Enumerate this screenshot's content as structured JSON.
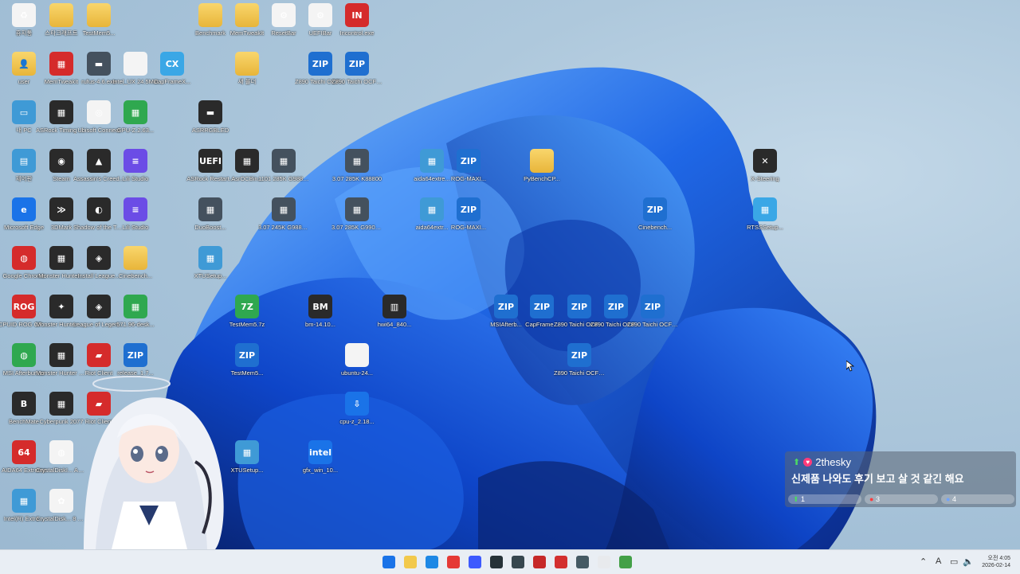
{
  "desktop": {
    "icons": [
      {
        "label": "휴지통",
        "glyph": "♻",
        "style": "g-white"
      },
      {
        "label": "스타크래프트",
        "glyph": "",
        "style": "g-folder"
      },
      {
        "label": "TestMem5...",
        "glyph": "",
        "style": "g-folder"
      },
      {
        "label": "Benchmark",
        "glyph": "",
        "style": "g-folder"
      },
      {
        "label": "MemTweakIt",
        "glyph": "",
        "style": "g-folder"
      },
      {
        "label": "ResetBar",
        "glyph": "⚙",
        "style": "g-white"
      },
      {
        "label": "UEFIBar",
        "glyph": "⚙",
        "style": "g-white"
      },
      {
        "label": "Incontrol.exe",
        "glyph": "IN",
        "style": "g-red"
      },
      {
        "label": "user",
        "glyph": "👤",
        "style": "g-folder"
      },
      {
        "label": "MemTweakIt",
        "glyph": "▦",
        "style": "g-red"
      },
      {
        "label": "rufus-4.6.exe",
        "glyph": "▬",
        "style": "g-gray"
      },
      {
        "label": "Intel_UX 24.5Mxt",
        "glyph": "",
        "style": "g-white"
      },
      {
        "label": "CapFrameX...",
        "glyph": "CX",
        "style": "g-cyan"
      },
      {
        "label": "새 폴더",
        "glyph": "",
        "style": "g-folder"
      },
      {
        "label": "Z890 Taichi OCF(3.03)R...",
        "glyph": "ZIP",
        "style": "g-zip"
      },
      {
        "label": "Z890 Taichi OCF(3.07)R...",
        "glyph": "ZIP",
        "style": "g-zip"
      },
      {
        "label": "내 PC",
        "glyph": "▭",
        "style": "g-teal"
      },
      {
        "label": "ASRock Timing Co...",
        "glyph": "▦",
        "style": "g-dark"
      },
      {
        "label": "Ubisoft Connect",
        "glyph": "◎",
        "style": "g-white"
      },
      {
        "label": "GPU-Z.2.63...",
        "glyph": "▦",
        "style": "g-green"
      },
      {
        "label": "ASRRGBLED",
        "glyph": "▬",
        "style": "g-dark"
      },
      {
        "label": "제어판",
        "glyph": "▤",
        "style": "g-teal"
      },
      {
        "label": "Steam",
        "glyph": "◉",
        "style": "g-dark"
      },
      {
        "label": "Assassin's Creed...",
        "glyph": "▲",
        "style": "g-dark"
      },
      {
        "label": "Lili Studio",
        "glyph": "≡",
        "style": "g-purple"
      },
      {
        "label": "ASRock Restart...",
        "glyph": "UEFI",
        "style": "g-dark"
      },
      {
        "label": "AsrOCBin...",
        "glyph": "▦",
        "style": "g-dark"
      },
      {
        "label": "1101 285K G98800 C...",
        "glyph": "▦",
        "style": "g-gray"
      },
      {
        "label": "3.07 285K K88800",
        "glyph": "▦",
        "style": "g-gray"
      },
      {
        "label": "aida64extre...",
        "glyph": "▦",
        "style": "g-teal"
      },
      {
        "label": "ROG-MAXI...",
        "glyph": "ZIP",
        "style": "g-zip"
      },
      {
        "label": "PyBenchCP...",
        "glyph": "",
        "style": "g-folder"
      },
      {
        "label": "X-Steering",
        "glyph": "✕",
        "style": "g-dark"
      },
      {
        "label": "Microsoft Edge",
        "glyph": "e",
        "style": "g-blue"
      },
      {
        "label": "3DMark",
        "glyph": "≫",
        "style": "g-dark"
      },
      {
        "label": "Shadow of the Tomb...",
        "glyph": "◐",
        "style": "g-dark"
      },
      {
        "label": "Lili Studio",
        "glyph": "≡",
        "style": "g-purple"
      },
      {
        "label": "DuoBoost...",
        "glyph": "▦",
        "style": "g-gray"
      },
      {
        "label": "3.07 245K G98800...",
        "glyph": "▦",
        "style": "g-gray"
      },
      {
        "label": "3.07 285K G99000...",
        "glyph": "▦",
        "style": "g-gray"
      },
      {
        "label": "aida64extr...",
        "glyph": "▦",
        "style": "g-teal"
      },
      {
        "label": "ROG-MAXI...",
        "glyph": "ZIP",
        "style": "g-zip"
      },
      {
        "label": "Cinebench...",
        "glyph": "ZIP",
        "style": "g-zip"
      },
      {
        "label": "RTSSSetup...",
        "glyph": "▦",
        "style": "g-cyan"
      },
      {
        "label": "Google Chrome",
        "glyph": "◍",
        "style": "g-red"
      },
      {
        "label": "Monster Hunter...",
        "glyph": "▦",
        "style": "g-dark"
      },
      {
        "label": "Install League...",
        "glyph": "◈",
        "style": "g-dark"
      },
      {
        "label": "Cinebench...",
        "glyph": "",
        "style": "g-folder"
      },
      {
        "label": "XTUSetup...",
        "glyph": "▦",
        "style": "g-teal"
      },
      {
        "label": "CPUID ROG CPU-Z",
        "glyph": "ROG",
        "style": "g-red"
      },
      {
        "label": "Monster Hunter Wilds",
        "glyph": "✦",
        "style": "g-dark"
      },
      {
        "label": "League of Legends",
        "glyph": "◈",
        "style": "g-dark"
      },
      {
        "label": "571.96-desk...",
        "glyph": "▦",
        "style": "g-green"
      },
      {
        "label": "TestMem5.7z",
        "glyph": "7Z",
        "style": "g-green"
      },
      {
        "label": "bm-14.10...",
        "glyph": "BM",
        "style": "g-dark"
      },
      {
        "label": "hwi64_840...",
        "glyph": "▥",
        "style": "g-dark"
      },
      {
        "label": "MSIAfterb...",
        "glyph": "ZIP",
        "style": "g-zip"
      },
      {
        "label": "CapFrame...",
        "glyph": "ZIP",
        "style": "g-zip"
      },
      {
        "label": "Z890 Taichi OCF(3.14)R...",
        "glyph": "ZIP",
        "style": "g-zip"
      },
      {
        "label": "Z890 Taichi OCF(3.17)R...",
        "glyph": "ZIP",
        "style": "g-zip"
      },
      {
        "label": "Z890 Taichi OCF(3.22)R...",
        "glyph": "ZIP",
        "style": "g-zip"
      },
      {
        "label": "MSI Afterburner",
        "glyph": "◍",
        "style": "g-green"
      },
      {
        "label": "Monster Hunter Wil...",
        "glyph": "▦",
        "style": "g-dark"
      },
      {
        "label": "Riot Client",
        "glyph": "▰",
        "style": "g-red"
      },
      {
        "label": "release_1.7...",
        "glyph": "ZIP",
        "style": "g-zip"
      },
      {
        "label": "TestMem5...",
        "glyph": "ZIP",
        "style": "g-zip"
      },
      {
        "label": "ubuntu-24...",
        "glyph": "",
        "style": "g-white"
      },
      {
        "label": "Z890 Taichi OCF(2.18)R...",
        "glyph": "ZIP",
        "style": "g-zip"
      },
      {
        "label": "BenchMate",
        "glyph": "B",
        "style": "g-dark"
      },
      {
        "label": "Cyberpunk 2077",
        "glyph": "▦",
        "style": "g-dark"
      },
      {
        "label": "Riot Client",
        "glyph": "▰",
        "style": "g-red"
      },
      {
        "label": "cpu-z_2.18...",
        "glyph": "⇩",
        "style": "g-blue"
      },
      {
        "label": "AIDA64 Extreme",
        "glyph": "64",
        "style": "g-red"
      },
      {
        "label": "CrystalDiskI... Aoi Edition",
        "glyph": "◍",
        "style": "g-white"
      },
      {
        "label": "XTUSetup...",
        "glyph": "▦",
        "style": "g-teal"
      },
      {
        "label": "gfx_win_10...",
        "glyph": "intel",
        "style": "g-blue"
      },
      {
        "label": "Intel(R) Extre...",
        "glyph": "▦",
        "style": "g-teal"
      },
      {
        "label": "CrystalDisk... 8 Aoi Editi...",
        "glyph": "✿",
        "style": "g-white"
      }
    ]
  },
  "chat": {
    "username": "2thesky",
    "message": "신제품 나와도 후기 보고 살 것 같긴 해요",
    "bars": [
      {
        "label": "1",
        "icon": "up"
      },
      {
        "label": "3",
        "icon": "red"
      },
      {
        "label": "4",
        "icon": "blue"
      }
    ]
  },
  "taskbar": {
    "pinned": [
      "start-icon",
      "file-explorer-icon",
      "edge-icon",
      "chrome-icon",
      "store-icon",
      "hwinfo-icon",
      "app-icon",
      "rog-cpuz-icon",
      "riot-icon",
      "terminal-icon",
      "snip-icon",
      "memory-icon"
    ],
    "tray": {
      "time": "오전 4:05",
      "date": "2026-02-14",
      "ime": "A"
    }
  },
  "colors": {
    "wave_dark": "#0b2f9a",
    "wave_mid": "#1a5fe0",
    "wave_light": "#5aa6ff",
    "taskbar": "#e9eef4"
  }
}
